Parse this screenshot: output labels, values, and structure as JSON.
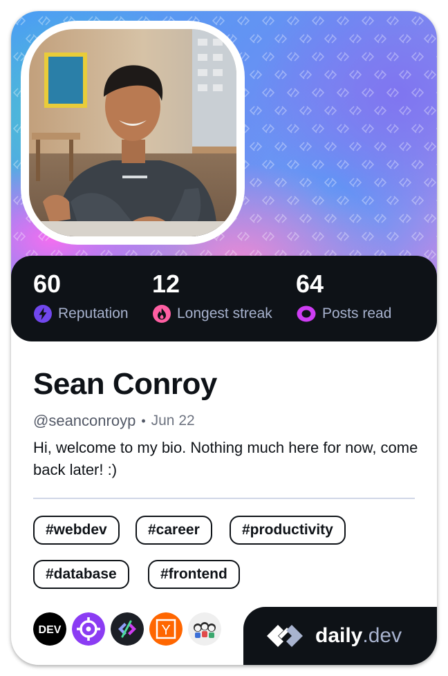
{
  "profile": {
    "name": "Sean Conroy",
    "handle": "@seanconroyp",
    "separator": "•",
    "joined": "Jun 22",
    "bio": "Hi, welcome to my bio. Nothing much here for now, come back later! :)"
  },
  "stats": [
    {
      "value": "60",
      "label": "Reputation",
      "icon": "lightning-icon",
      "color": "#7147ed"
    },
    {
      "value": "12",
      "label": "Longest streak",
      "icon": "flame-icon",
      "color": "#ff5fa3"
    },
    {
      "value": "64",
      "label": "Posts read",
      "icon": "eye-ring-icon",
      "color": "#ce3df3"
    }
  ],
  "tags": [
    "#webdev",
    "#career",
    "#productivity",
    "#database",
    "#frontend"
  ],
  "sources": [
    {
      "name": "DEV",
      "label": "DEV",
      "icon": "dev-logo-icon",
      "color": "#000000"
    },
    {
      "name": "crosshair",
      "label": "",
      "icon": "crosshair-icon",
      "color": "#8b3cf3"
    },
    {
      "name": "dailydev",
      "label": "",
      "icon": "daily-dev-logo-icon",
      "color": "#1c1f26"
    },
    {
      "name": "Y",
      "label": "Y",
      "icon": "hacker-news-icon",
      "color": "#ff6600"
    },
    {
      "name": "people",
      "label": "",
      "icon": "people-avatars-icon",
      "color": "#efefef"
    }
  ],
  "brand": {
    "name": "daily",
    "suffix": ".dev"
  },
  "colors": {
    "dark": "#0e1217",
    "muted": "#a8b3cf",
    "white": "#ffffff"
  }
}
